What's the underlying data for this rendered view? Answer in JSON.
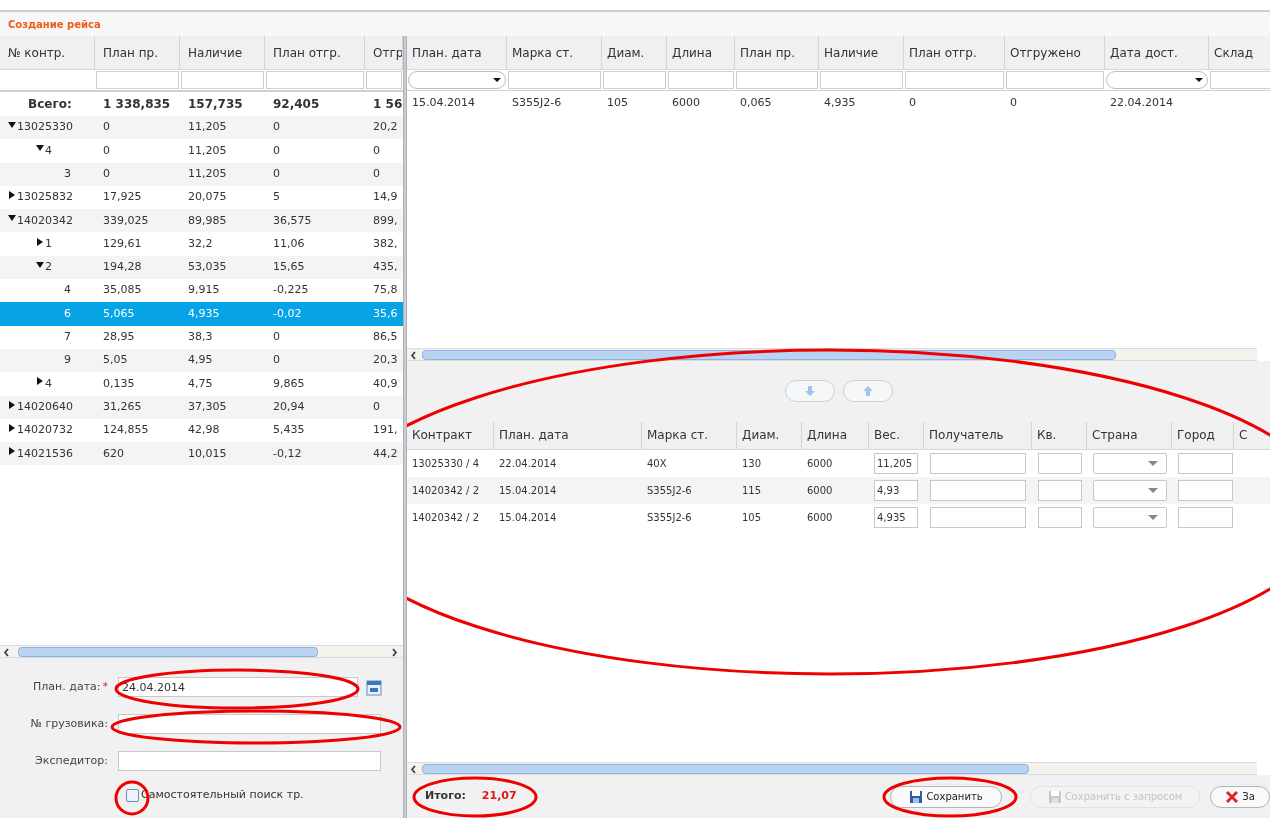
{
  "title": "Создание рейса",
  "contracts_table": {
    "columns": [
      "№ контр.",
      "План пр.",
      "Наличие",
      "План отгр.",
      "Отгр"
    ],
    "total": {
      "label": "Всего:",
      "values": [
        "1 338,835",
        "157,735",
        "92,405",
        "1 56"
      ]
    },
    "rows": [
      {
        "label": "13025330",
        "values": [
          "0",
          "11,205",
          "0",
          "20,2"
        ],
        "expanded": true,
        "selected": false,
        "children": [
          {
            "label": "4",
            "values": [
              "0",
              "11,205",
              "0",
              "0"
            ],
            "expanded": true,
            "selected": false,
            "children": [
              {
                "label": "3",
                "values": [
                  "0",
                  "11,205",
                  "0",
                  "0"
                ],
                "selected": false
              }
            ]
          }
        ]
      },
      {
        "label": "13025832",
        "values": [
          "17,925",
          "20,075",
          "5",
          "14,9"
        ],
        "expanded": false,
        "selected": false
      },
      {
        "label": "14020342",
        "values": [
          "339,025",
          "89,985",
          "36,575",
          "899,"
        ],
        "expanded": true,
        "selected": false,
        "children": [
          {
            "label": "1",
            "values": [
              "129,61",
              "32,2",
              "11,06",
              "382,"
            ],
            "expanded": false,
            "selected": false
          },
          {
            "label": "2",
            "values": [
              "194,28",
              "53,035",
              "15,65",
              "435,"
            ],
            "expanded": true,
            "selected": false,
            "children": [
              {
                "label": "4",
                "values": [
                  "35,085",
                  "9,915",
                  "-0,225",
                  "75,8"
                ],
                "selected": false
              },
              {
                "label": "6",
                "values": [
                  "5,065",
                  "4,935",
                  "-0,02",
                  "35,6"
                ],
                "selected": true
              },
              {
                "label": "7",
                "values": [
                  "28,95",
                  "38,3",
                  "0",
                  "86,5"
                ],
                "selected": false
              },
              {
                "label": "9",
                "values": [
                  "5,05",
                  "4,95",
                  "0",
                  "20,3"
                ],
                "selected": false
              }
            ]
          },
          {
            "label": "4",
            "values": [
              "0,135",
              "4,75",
              "9,865",
              "40,9"
            ],
            "expanded": false,
            "selected": false
          }
        ]
      },
      {
        "label": "14020640",
        "values": [
          "31,265",
          "37,305",
          "20,94",
          "0"
        ],
        "expanded": false,
        "selected": false
      },
      {
        "label": "14020732",
        "values": [
          "124,855",
          "42,98",
          "5,435",
          "191,"
        ],
        "expanded": false,
        "selected": false
      },
      {
        "label": "14021536",
        "values": [
          "620",
          "10,015",
          "-0,12",
          "44,2"
        ],
        "expanded": false,
        "selected": false
      }
    ]
  },
  "form": {
    "fields": [
      {
        "kind": "date",
        "label": "План. дата:",
        "required_mark": "*",
        "value": "24.04.2014"
      },
      {
        "kind": "text",
        "label": "№ грузовика:"
      },
      {
        "kind": "text",
        "label": "Экспедитор:"
      }
    ],
    "checkbox": {
      "label": "Самостоятельный поиск тр.",
      "checked": false
    }
  },
  "items_table": {
    "columns": [
      {
        "label": "План. дата",
        "kind": "dropdown"
      },
      {
        "label": "Марка ст.",
        "kind": "text"
      },
      {
        "label": "Диам.",
        "kind": "text"
      },
      {
        "label": "Длина",
        "kind": "text"
      },
      {
        "label": "План пр.",
        "kind": "text"
      },
      {
        "label": "Наличие",
        "kind": "text"
      },
      {
        "label": "План отгр.",
        "kind": "text"
      },
      {
        "label": "Отгружено",
        "kind": "text"
      },
      {
        "label": "Дата дост.",
        "kind": "dropdown"
      },
      {
        "label": "Склад",
        "kind": "text"
      }
    ],
    "rows": [
      [
        "15.04.2014",
        "S355J2-6",
        "105",
        "6000",
        "0,065",
        "4,935",
        "0",
        "0",
        "22.04.2014"
      ]
    ]
  },
  "trip_table": {
    "columns": [
      "Контракт",
      "План. дата",
      "Марка ст.",
      "Диам.",
      "Длина",
      "Вес.",
      "Получатель",
      "Кв.",
      "Страна",
      "Город",
      "С"
    ],
    "rows": [
      {
        "contract": "13025330 / 4",
        "date": "22.04.2014",
        "grade": "40X",
        "diameter": "130",
        "length": "6000",
        "weight": "11,205"
      },
      {
        "contract": "14020342 / 2",
        "date": "15.04.2014",
        "grade": "S355J2-6",
        "diameter": "115",
        "length": "6000",
        "weight": "4,93"
      },
      {
        "contract": "14020342 / 2",
        "date": "15.04.2014",
        "grade": "S355J2-6",
        "diameter": "105",
        "length": "6000",
        "weight": "4,935"
      }
    ]
  },
  "footer": {
    "total_label": "Итого:",
    "total_value": "21,07",
    "buttons": [
      {
        "kind": "save",
        "label": "Сохранить",
        "disabled": false
      },
      {
        "kind": "save",
        "label": "Сохранить с запросом",
        "disabled": true
      },
      {
        "kind": "close",
        "label": "За",
        "disabled": false
      }
    ]
  }
}
